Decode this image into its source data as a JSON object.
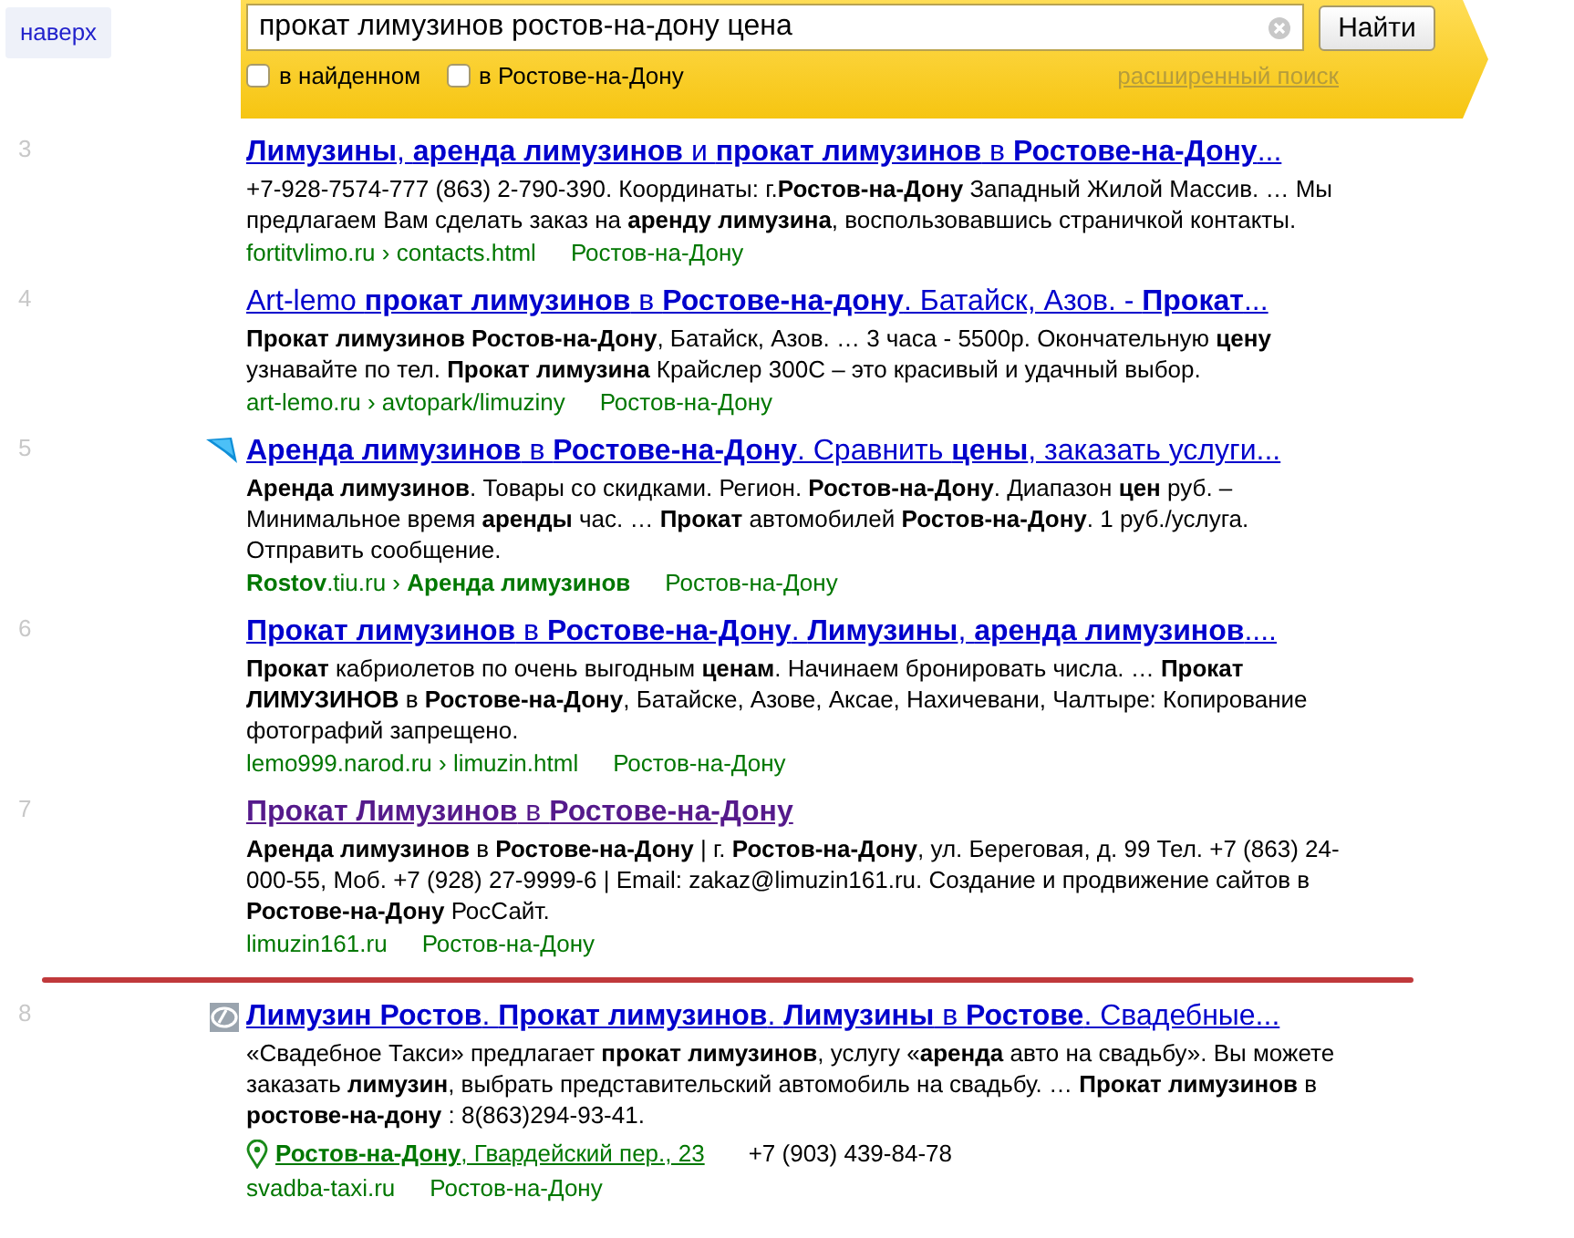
{
  "top_button": {
    "label": "наверх"
  },
  "search": {
    "value": "прокат лимузинов ростов-на-дону цена",
    "button": "Найти",
    "options": [
      {
        "label": "в найденном",
        "checked": false
      },
      {
        "label": "в Ростове-на-Дону",
        "checked": false
      }
    ],
    "advanced_link": "расширенный поиск"
  },
  "results": [
    {
      "number": "3",
      "kind": "plain",
      "visited": false,
      "title": "**Лимузины**, **аренда лимузинов** и **прокат лимузинов** в **Ростове-на-Дону**...",
      "snippet": "+7-928-7574-777 (863) 2-790-390. Координаты: г.**Ростов-на-Дону** Западный Жилой Массив. … Мы предлагаем Вам сделать заказ на **аренду лимузина**, воспользовавшись страничкой контакты.",
      "url": "fortitvlimo.ru › contacts.html",
      "region": "Ростов-на-Дону",
      "divider_after": false
    },
    {
      "number": "4",
      "kind": "plain",
      "visited": false,
      "title": "Art-lemo **прокат лимузинов** в **Ростове-на-дону**. Батайск, Азов. - **Прокат**...",
      "snippet": "**Прокат лимузинов Ростов-на-Дону**, Батайск, Азов. … 3 часа - 5500р. Окончательную **цену** узнавайте по тел. **Прокат лимузина** Крайслер 300C – это красивый и удачный выбор.",
      "url": "art-lemo.ru › avtopark/limuziny",
      "region": "Ростов-на-Дону",
      "divider_after": false
    },
    {
      "number": "5",
      "kind": "flagged",
      "visited": false,
      "title": "**Аренда лимузинов** в **Ростове-на-Дону**. Сравнить **цены**, заказать услуги...",
      "snippet": "**Аренда лимузинов**. Товары со скидками. Регион. **Ростов-на-Дону**. Диапазон **цен** руб. – Минимальное время **аренды** час. … **Прокат** автомобилей **Ростов-на-Дону**. 1 руб./услуга. Отправить сообщение.",
      "url": "**Rostov**.tiu.ru › **Аренда лимузинов**",
      "region": "Ростов-на-Дону",
      "divider_after": false
    },
    {
      "number": "6",
      "kind": "plain",
      "visited": false,
      "title": "**Прокат лимузинов** в **Ростове-на-Дону**. **Лимузины**, **аренда лимузинов**....",
      "snippet": "**Прокат** кабриолетов по очень выгодным **ценам**. Начинаем бронировать числа. … **Прокат ЛИМУЗИНОВ** в **Ростове-на-Дону**, Батайске, Азове, Аксае, Нахичевани, Чалтыре: Копирование фотографий запрещено.",
      "url": "lemo999.narod.ru › limuzin.html",
      "region": "Ростов-на-Дону",
      "divider_after": false
    },
    {
      "number": "7",
      "kind": "plain",
      "visited": true,
      "title": "**Прокат Лимузинов** в **Ростове-на-Дону**",
      "snippet": "**Аренда лимузинов** в **Ростове-на-Дону** | г. **Ростов-на-Дону**, ул. Береговая, д. 99 Тел. +7 (863) 24-000-55, Моб. +7 (928) 27-9999-6 | Email: zakaz@limuzin161.ru. Создание и продвижение сайтов в **Ростове-на-Дону** РосСайт.",
      "url": "limuzin161.ru",
      "region": "Ростов-на-Дону",
      "divider_after": true
    },
    {
      "number": "8",
      "kind": "favicon",
      "visited": false,
      "title": "**Лимузин Ростов**. **Прокат лимузинов**. **Лимузины** в **Ростове**. Свадебные...",
      "snippet": "«Свадебное Такси» предлагает **прокат лимузинов**, услугу «**аренда** авто на свадьбу». Вы можете заказать **лимузин**, выбрать представительский автомобиль на свадьбу. … **Прокат лимузинов** в **ростове-на-дону** : 8(863)294-93-41.",
      "address": "**Ростов-на-Дону**, Гвардейский пер., 23",
      "phone": "+7 (903) 439-84-78",
      "url": "svadba-taxi.ru",
      "region": "Ростов-на-Дону",
      "divider_after": false
    }
  ]
}
